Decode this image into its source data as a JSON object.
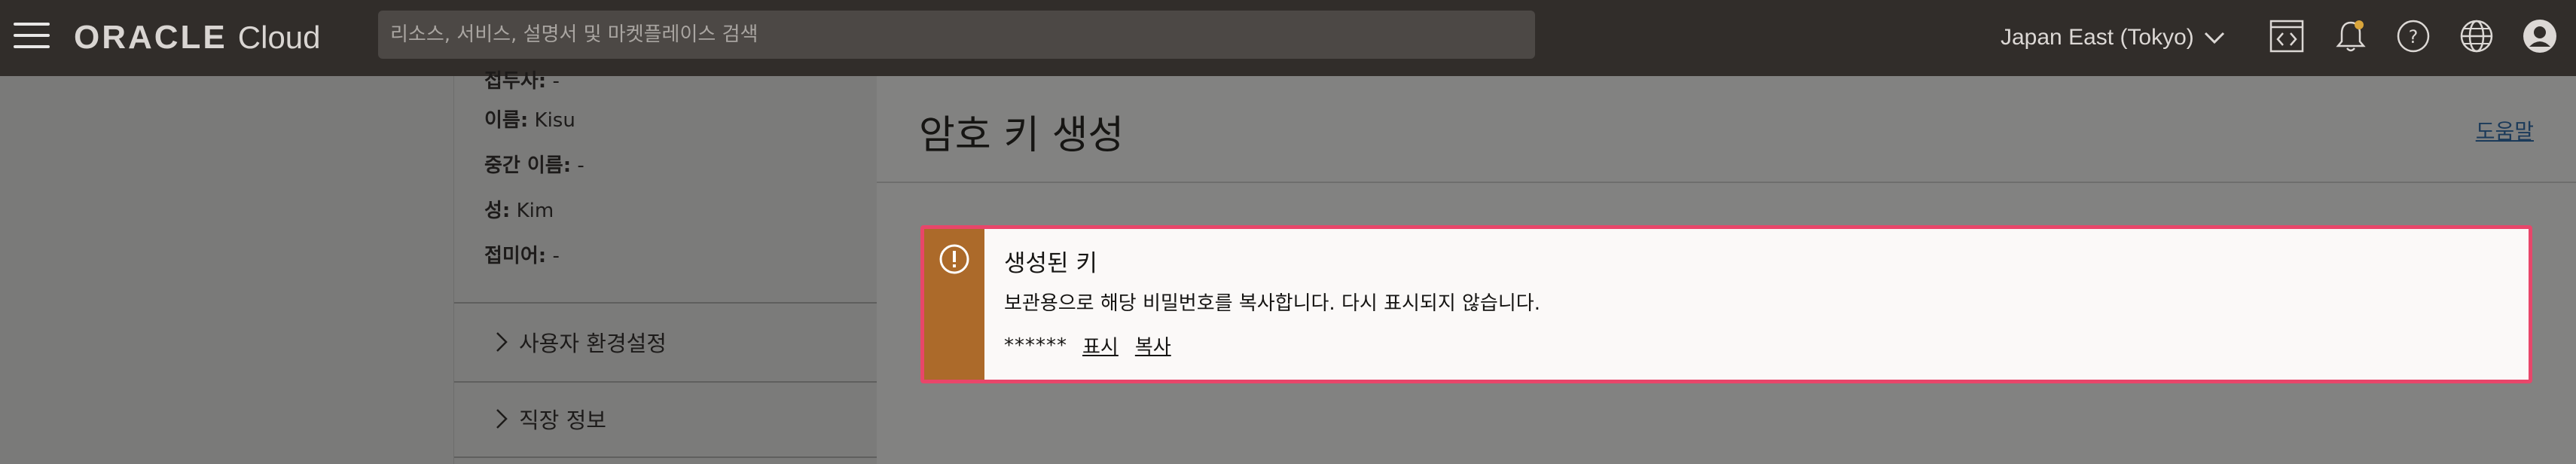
{
  "header": {
    "logo_brand": "ORACLE",
    "logo_product": "Cloud",
    "search_placeholder": "리소스, 서비스, 설명서 및 마켓플레이스 검색",
    "region": "Japan East (Tokyo)",
    "icons": [
      "code-editor-icon",
      "bell-icon",
      "help-icon",
      "globe-icon",
      "user-icon"
    ]
  },
  "profile": {
    "cut_label": "접두사:",
    "cut_value": "-",
    "first_name_label": "이름:",
    "first_name_value": "Kisu",
    "middle_name_label": "중간 이름:",
    "middle_name_value": "-",
    "last_name_label": "성:",
    "last_name_value": "Kim",
    "suffix_label": "접미어:",
    "suffix_value": "-",
    "sections": [
      {
        "label": "사용자 환경설정"
      },
      {
        "label": "직장 정보"
      }
    ]
  },
  "panel": {
    "title": "암호 키 생성",
    "help_link": "도움말"
  },
  "alert": {
    "title": "생성된 키",
    "message": "보관용으로 해당 비밀번호를 복사합니다. 다시 표시되지 않습니다.",
    "masked_value": "******",
    "show_link": "표시",
    "copy_link": "복사",
    "accent_color": "#ac6a2a",
    "highlight_color": "#e8466a"
  }
}
